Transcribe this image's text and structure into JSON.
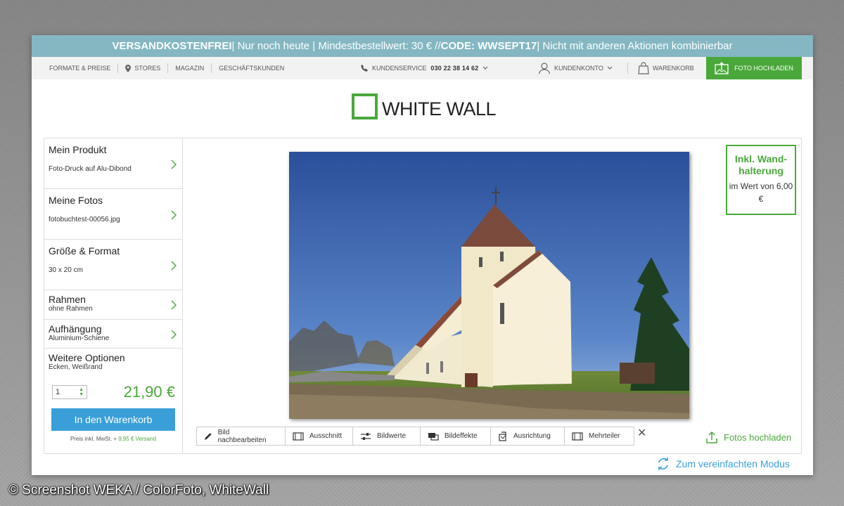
{
  "promo": {
    "strong1": "VERSANDKOSTENFREI",
    "text1": " | Nur noch heute | Mindestbestellwert: 30 € // ",
    "strong2": "CODE: WWSEPT17",
    "text2": "| Nicht mit anderen Aktionen kombinierbar"
  },
  "nav": {
    "formate": "FORMATE & PREISE",
    "stores": "STORES",
    "magazin": "MAGAZIN",
    "geschaeft": "GESCHÄFTSKUNDEN",
    "kundenservice": "KUNDENSERVICE",
    "phone": "030 22 38 14 62",
    "kundenkonto": "KUNDENKONTO",
    "warenkorb": "WARENKORB",
    "upload": "FOTO HOCHLADEN"
  },
  "logo": {
    "text": "WHITE WALL"
  },
  "sidebar": {
    "items": [
      {
        "title": "Mein Produkt",
        "value": "Foto-Druck auf Alu-Dibond"
      },
      {
        "title": "Meine Fotos",
        "value": "fotobuchtest-00056.jpg"
      },
      {
        "title": "Größe & Format",
        "value": "30 x 20 cm"
      },
      {
        "title": "Rahmen",
        "value": "ohne Rahmen"
      },
      {
        "title": "Aufhängung",
        "value": "Aluminium-Schiene"
      },
      {
        "title": "Weitere Optionen",
        "value": "Ecken, Weißrand"
      }
    ],
    "quantity": "1",
    "price": "21,90 €",
    "cart_button": "In den Warenkorb",
    "vat_text": "Preis inkl. MwSt. + ",
    "shipping": "9,95 € Versand"
  },
  "promo_box": {
    "title": "Inkl. Wand-halterung",
    "sub": "im Wert von 6,00 €"
  },
  "toolbar": {
    "tools": [
      {
        "label": "Bild nachbearbeiten",
        "icon": "pencil-icon"
      },
      {
        "label": "Ausschnitt",
        "icon": "crop-icon"
      },
      {
        "label": "Bildwerte",
        "icon": "sliders-icon"
      },
      {
        "label": "Bildeffekte",
        "icon": "effects-icon"
      },
      {
        "label": "Ausrichtung",
        "icon": "orientation-icon"
      },
      {
        "label": "Mehrteiler",
        "icon": "multipart-icon"
      }
    ],
    "close": "✕"
  },
  "fotos_hochladen": "Fotos hochladen",
  "simple_mode": "Zum vereinfachten Modus",
  "credit": "© Screenshot WEKA / ColorFoto, WhiteWall",
  "colors": {
    "accent_green": "#4aa83b",
    "accent_blue": "#3a9fd8",
    "promo_bar": "#84b7c2"
  }
}
